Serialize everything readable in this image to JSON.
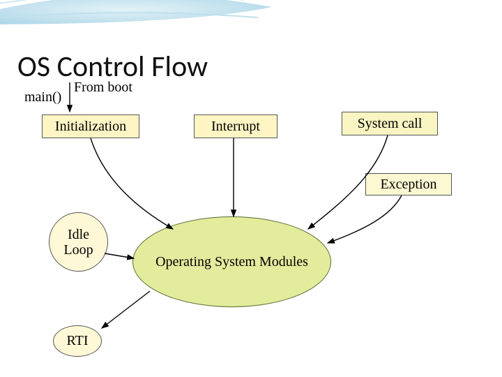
{
  "title": "OS Control Flow",
  "labels": {
    "main": "main()",
    "fromBoot": "From boot"
  },
  "boxes": {
    "init": "Initialization",
    "interrupt": "Interrupt",
    "syscall": "System call",
    "exception": "Exception"
  },
  "circles": {
    "idle": "Idle\nLoop",
    "rti": "RTI"
  },
  "ellipse": {
    "osm": "Operating System Modules"
  }
}
